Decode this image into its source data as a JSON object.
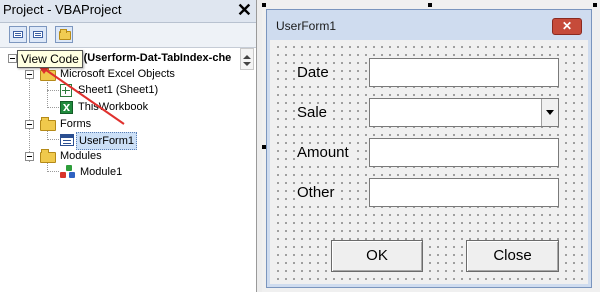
{
  "project_pane": {
    "title": "Project - VBAProject",
    "close_glyph": "✕",
    "toolbar": [
      {
        "icon": "view-code-icon"
      },
      {
        "icon": "view-object-icon"
      },
      {
        "icon": "toggle-folders-icon"
      }
    ],
    "tooltip": "View Code",
    "tree": {
      "project": "VBAProject (Userform-Dat-TabIndex-che",
      "excel_objects": "Microsoft Excel Objects",
      "sheet1": "Sheet1 (Sheet1)",
      "thisworkbook": "ThisWorkbook",
      "forms": "Forms",
      "userform1": "UserForm1",
      "modules": "Modules",
      "module1": "Module1"
    },
    "annotation_color": "#e0312e"
  },
  "userform": {
    "title": "UserForm1",
    "close_glyph": "✕",
    "fields": [
      {
        "label": "Date",
        "value": ""
      },
      {
        "label": "Sale",
        "value": ""
      },
      {
        "label": "Amount",
        "value": ""
      },
      {
        "label": "Other",
        "value": ""
      }
    ],
    "buttons": {
      "ok": "OK",
      "close": "Close"
    }
  }
}
